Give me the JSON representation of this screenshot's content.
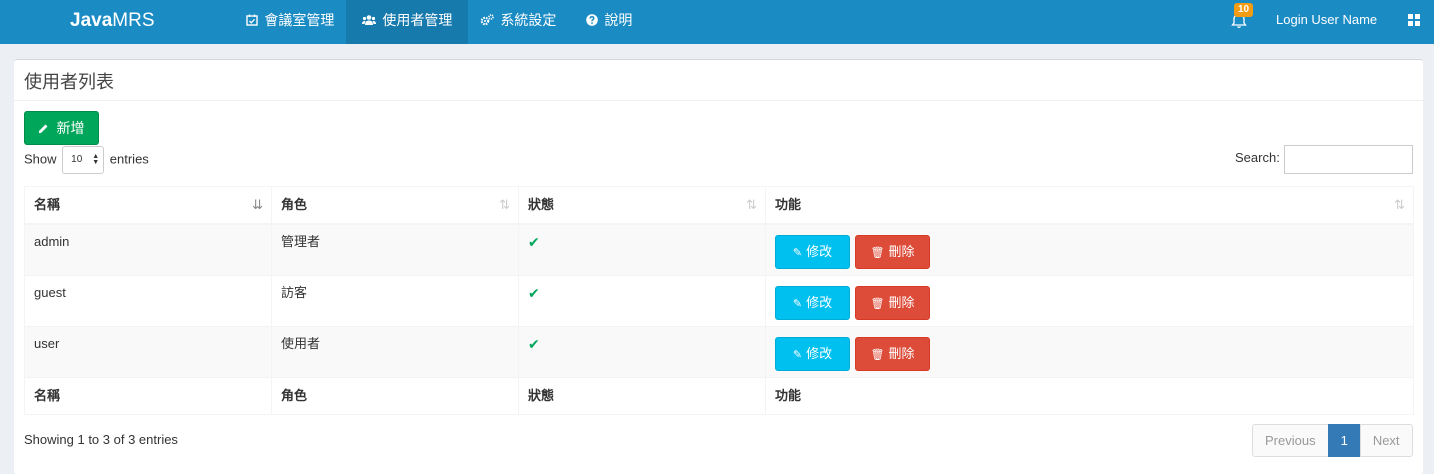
{
  "navbar": {
    "brand_bold": "Java",
    "brand_thin": "MRS",
    "items": [
      {
        "label": "會議室管理",
        "icon": "calendar-check-icon"
      },
      {
        "label": "使用者管理",
        "icon": "users-icon"
      },
      {
        "label": "系統設定",
        "icon": "gears-icon"
      },
      {
        "label": "說明",
        "icon": "question-circle-icon"
      }
    ],
    "notification_count": "10",
    "user_name": "Login User Name",
    "color": "#1b8bc4",
    "active_color": "#167aad"
  },
  "box": {
    "title": "使用者列表",
    "add_label": "新增",
    "show_label": "Show",
    "length_value": "10",
    "entries_label": "entries",
    "search_label": "Search:",
    "search_value": ""
  },
  "table": {
    "columns": [
      "名稱",
      "角色",
      "狀態",
      "功能"
    ],
    "rows": [
      {
        "name": "admin",
        "role": "管理者",
        "status": "✔",
        "edit": "修改",
        "delete": "刪除"
      },
      {
        "name": "guest",
        "role": "訪客",
        "status": "✔",
        "edit": "修改",
        "delete": "刪除"
      },
      {
        "name": "user",
        "role": "使用者",
        "status": "✔",
        "edit": "修改",
        "delete": "刪除"
      }
    ],
    "footer": [
      "名稱",
      "角色",
      "狀態",
      "功能"
    ]
  },
  "info": "Showing 1 to 3 of 3 entries",
  "pagination": {
    "previous": "Previous",
    "current": "1",
    "next": "Next"
  },
  "colors": {
    "add": "#00a65a",
    "edit": "#00c0ef",
    "delete": "#dd4b39",
    "status_ok": "#00a65a",
    "page_active": "#337ab7"
  }
}
